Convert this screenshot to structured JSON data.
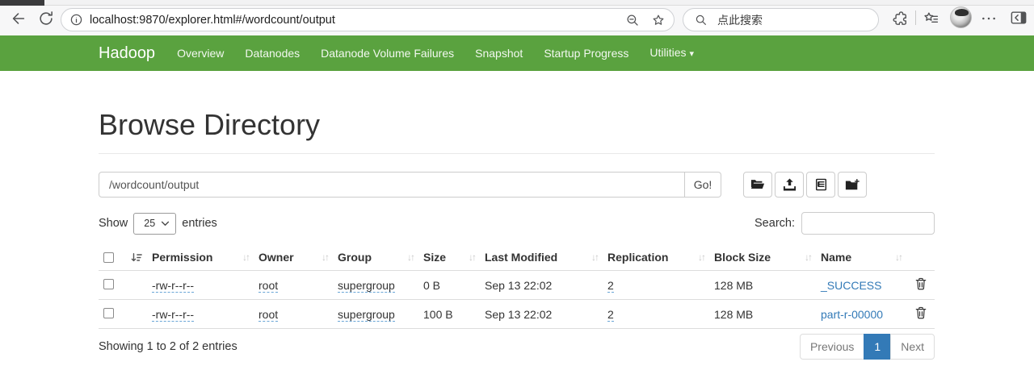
{
  "browser": {
    "url": "localhost:9870/explorer.html#/wordcount/output",
    "search_placeholder": "点此搜索"
  },
  "navbar": {
    "brand": "Hadoop",
    "items": [
      "Overview",
      "Datanodes",
      "Datanode Volume Failures",
      "Snapshot",
      "Startup Progress"
    ],
    "utilities": "Utilities"
  },
  "explorer": {
    "title": "Browse Directory",
    "path": "/wordcount/output",
    "go_label": "Go!",
    "show_label": "Show",
    "entries_label": "entries",
    "page_size": "25",
    "search_label": "Search:",
    "table": {
      "headers": [
        "Permission",
        "Owner",
        "Group",
        "Size",
        "Last Modified",
        "Replication",
        "Block Size",
        "Name"
      ],
      "rows": [
        {
          "permission": "-rw-r--r--",
          "owner": "root",
          "group": "supergroup",
          "size": "0 B",
          "modified": "Sep 13 22:02",
          "replication": "2",
          "block_size": "128 MB",
          "name": "_SUCCESS"
        },
        {
          "permission": "-rw-r--r--",
          "owner": "root",
          "group": "supergroup",
          "size": "100 B",
          "modified": "Sep 13 22:02",
          "replication": "2",
          "block_size": "128 MB",
          "name": "part-r-00000"
        }
      ]
    },
    "footer": {
      "info": "Showing 1 to 2 of 2 entries",
      "previous": "Previous",
      "page": "1",
      "next": "Next"
    }
  },
  "icons": {
    "sort_pair": "↓↑",
    "caret_down": "▾"
  },
  "colors": {
    "navbar_green": "#5aa23f",
    "link_blue": "#337ab7",
    "active_page_bg": "#337ab7"
  }
}
